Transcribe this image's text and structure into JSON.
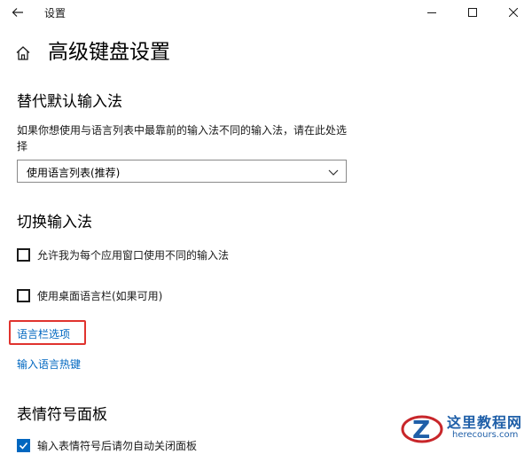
{
  "window": {
    "title": "设置",
    "back_icon": "back-arrow-icon",
    "min_icon": "minimize-icon",
    "max_icon": "maximize-icon",
    "close_icon": "close-icon"
  },
  "page": {
    "title": "高级键盘设置",
    "home_icon": "home-icon"
  },
  "override_section": {
    "title": "替代默认输入法",
    "description": "如果你想使用与语言列表中最靠前的输入法不同的输入法，请在此处选择",
    "select_value": "使用语言列表(推荐)"
  },
  "switch_section": {
    "title": "切换输入法",
    "per_app_label": "允许我为每个应用窗口使用不同的输入法",
    "per_app_checked": false,
    "desktop_bar_label": "使用桌面语言栏(如果可用)",
    "desktop_bar_checked": false,
    "language_bar_link": "语言栏选项",
    "hotkeys_link": "输入语言热键"
  },
  "emoji_section": {
    "title": "表情符号面板",
    "auto_close_label": "输入表情符号后请勿自动关闭面板",
    "auto_close_checked": true
  },
  "watermark": {
    "name": "这里教程网",
    "url": "herecours.com"
  },
  "colors": {
    "accent": "#0067c0",
    "highlight": "#e0332e"
  }
}
